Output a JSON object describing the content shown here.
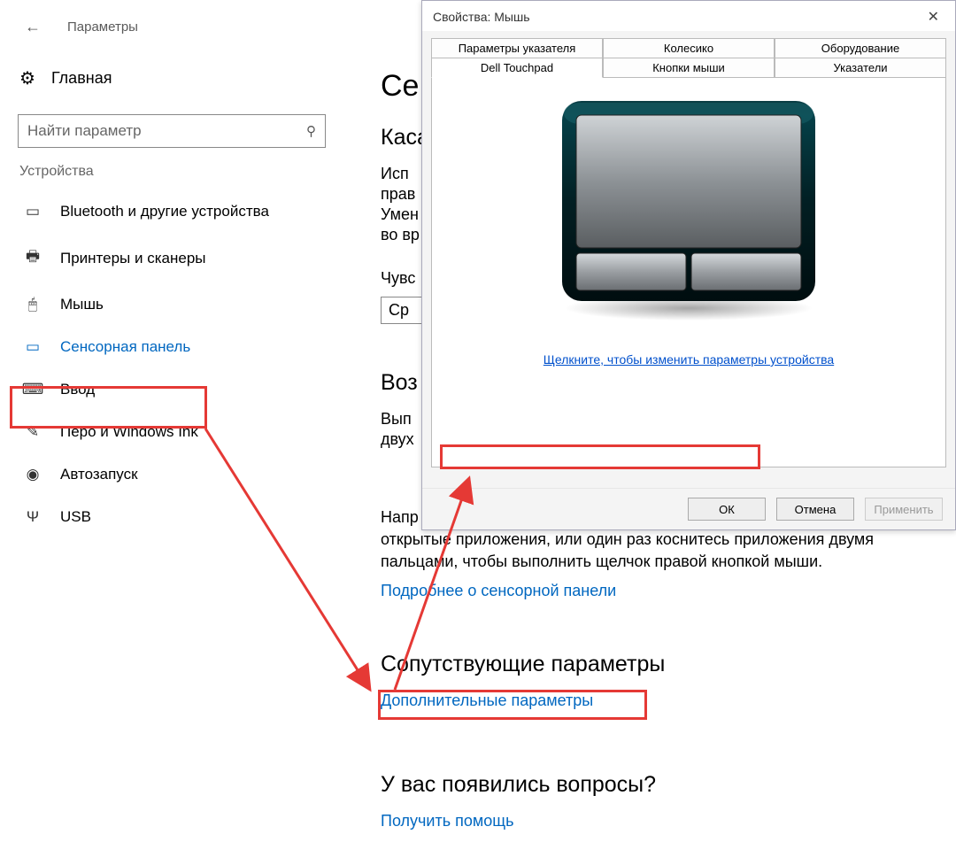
{
  "settings": {
    "window_title": "Параметры",
    "home_label": "Главная",
    "search_placeholder": "Найти параметр",
    "category_label": "Устройства",
    "nav": [
      {
        "icon": "devices-icon",
        "label": "Bluetooth и другие устройства"
      },
      {
        "icon": "printer-icon",
        "label": "Принтеры и сканеры"
      },
      {
        "icon": "mouse-icon",
        "label": "Мышь"
      },
      {
        "icon": "touchpad-icon",
        "label": "Сенсорная панель",
        "selected": true
      },
      {
        "icon": "keyboard-icon",
        "label": "Ввод"
      },
      {
        "icon": "pen-icon",
        "label": "Перо и Windows Ink"
      },
      {
        "icon": "autoplay-icon",
        "label": "Автозапуск"
      },
      {
        "icon": "usb-icon",
        "label": "USB"
      }
    ]
  },
  "main": {
    "page_title_trunc": "Се",
    "section_taps_trunc": "Каса",
    "desc_line1": "Исп",
    "desc_line2": "прав",
    "desc_line3": "Умен",
    "desc_line4": "во вр",
    "sens_label_trunc": "Чувс",
    "dropdown_value_trunc": "Ср",
    "section_features_trunc": "Воз",
    "feat_line1": "Вып",
    "feat_line2": "двух",
    "feat_line3": "Напр",
    "feat_rest": "открытые приложения, или один раз коснитесь приложения двумя пальцами, чтобы выполнить щелчок правой кнопкой мыши.",
    "learn_more": "Подробнее о сенсорной панели",
    "related_header": "Сопутствующие параметры",
    "related_link": "Дополнительные параметры",
    "help_header": "У вас появились вопросы?",
    "help_link": "Получить помощь"
  },
  "dialog": {
    "title": "Свойства: Мышь",
    "tabs_top": [
      "Параметры указателя",
      "Колесико",
      "Оборудование"
    ],
    "tabs_bot": [
      "Dell Touchpad",
      "Кнопки мыши",
      "Указатели"
    ],
    "active_tab": "Dell Touchpad",
    "device_link": "Щелкните, чтобы изменить параметры устройства ",
    "buttons": {
      "ok": "ОК",
      "cancel": "Отмена",
      "apply": "Применить"
    }
  }
}
